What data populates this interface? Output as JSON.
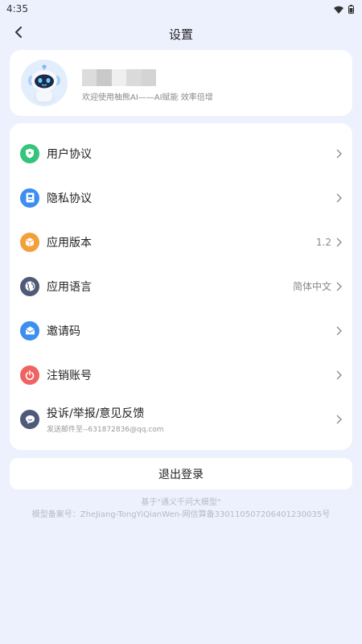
{
  "status_bar": {
    "time": "4:35"
  },
  "header": {
    "title": "设置"
  },
  "profile": {
    "welcome": "欢迎使用柚熊AI——AI赋能 效率倍增"
  },
  "menu": {
    "items": [
      {
        "label": "用户协议",
        "icon": "shield-icon",
        "color": "#34c47a",
        "value": "",
        "sub": ""
      },
      {
        "label": "隐私协议",
        "icon": "document-icon",
        "color": "#3d8ef0",
        "value": "",
        "sub": ""
      },
      {
        "label": "应用版本",
        "icon": "box-icon",
        "color": "#f3a03a",
        "value": "1.2",
        "sub": ""
      },
      {
        "label": "应用语言",
        "icon": "globe-icon",
        "color": "#4f5a78",
        "value": "简体中文",
        "sub": ""
      },
      {
        "label": "邀请码",
        "icon": "envelope-icon",
        "color": "#3d8ef0",
        "value": "",
        "sub": ""
      },
      {
        "label": "注销账号",
        "icon": "power-icon",
        "color": "#f06363",
        "value": "",
        "sub": ""
      },
      {
        "label": "投诉/举报/意见反馈",
        "icon": "chat-icon",
        "color": "#4f5a78",
        "value": "",
        "sub": "发送邮件至--631872836@qq.com"
      }
    ]
  },
  "logout_label": "退出登录",
  "footer": {
    "line1": "基于\"通义千问大模型\"",
    "line2": "模型备案号：ZheJiang-TongYiQianWen-网信算备330110507206401230035号"
  }
}
